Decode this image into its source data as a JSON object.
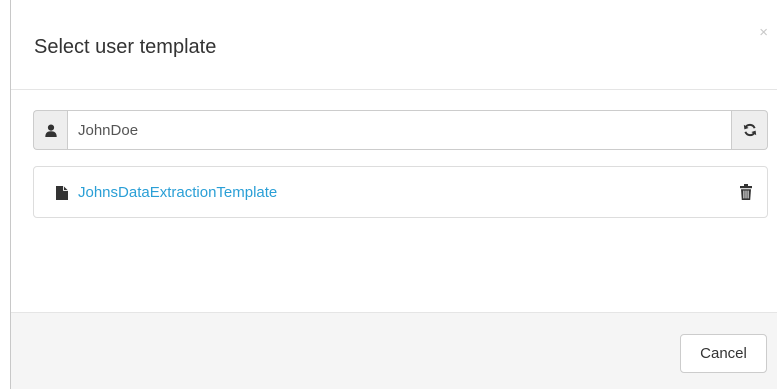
{
  "dialog": {
    "title": "Select user template",
    "close_label": "×"
  },
  "user_field": {
    "value": "JohnDoe",
    "icon": "user-icon",
    "refresh_icon": "refresh-icon"
  },
  "templates": {
    "items": [
      {
        "name": "JohnsDataExtractionTemplate",
        "icon": "file-icon",
        "action_icon": "trash-icon"
      }
    ]
  },
  "footer": {
    "cancel_label": "Cancel"
  },
  "colors": {
    "link": "#2a9fd6",
    "footer_bg": "#f5f5f5",
    "addon_bg": "#eeeeee"
  }
}
